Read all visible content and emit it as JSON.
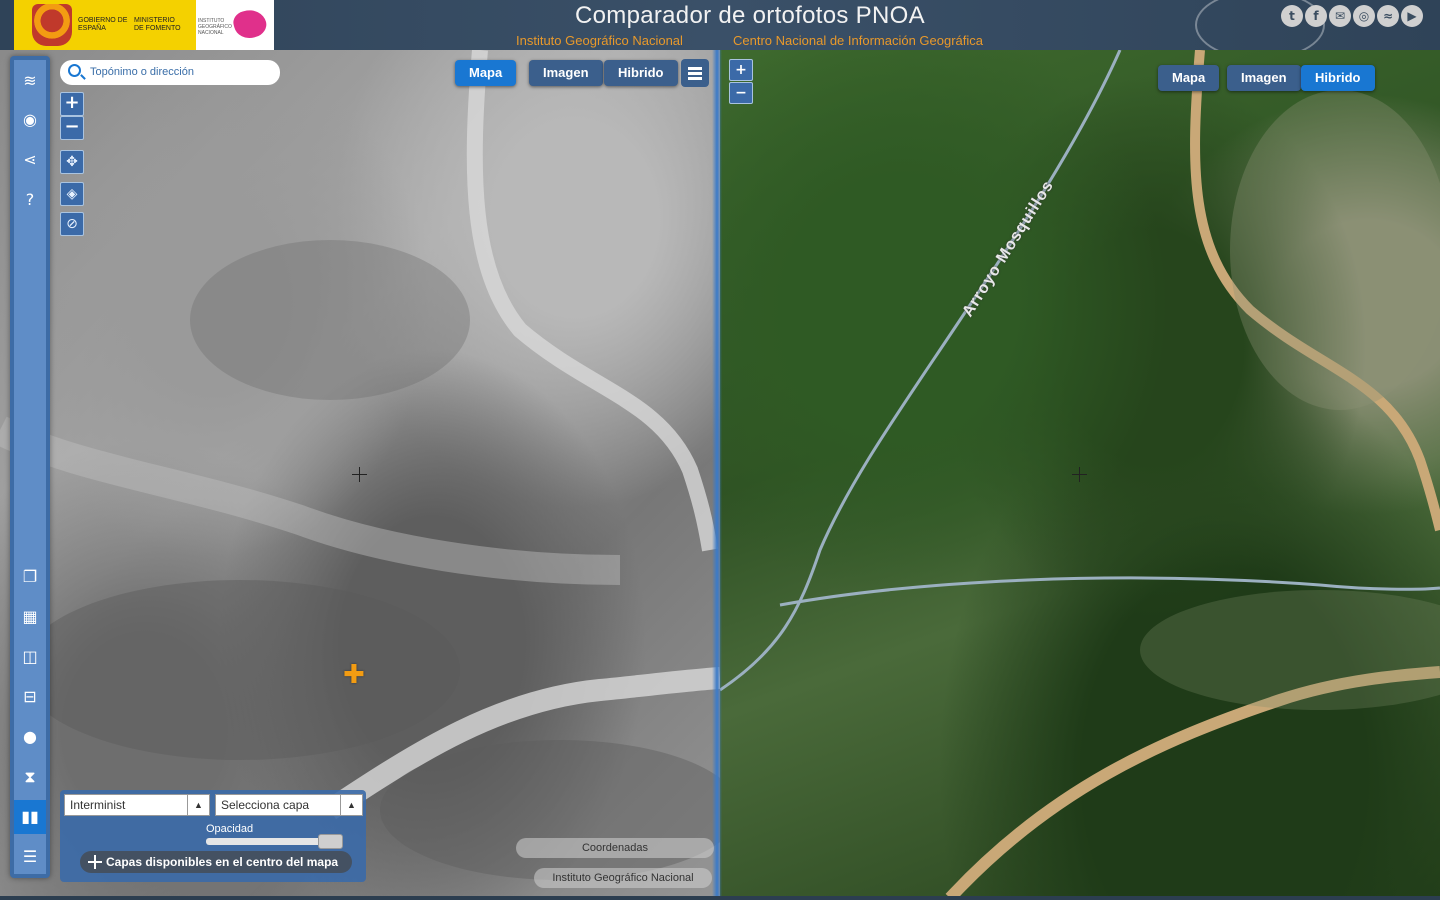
{
  "header": {
    "title": "Comparador de ortofotos PNOA",
    "subtitle_left": "Instituto Geográfico Nacional",
    "subtitle_right": "Centro Nacional de Información Geográfica",
    "logo_gobierno": "GOBIERNO DE ESPAÑA",
    "logo_ministerio": "MINISTERIO DE FOMENTO",
    "logo_ign": "INSTITUTO GEOGRÁFICO NACIONAL",
    "social": [
      {
        "icon": "twitter-icon",
        "glyph": "t"
      },
      {
        "icon": "facebook-icon",
        "glyph": "f"
      },
      {
        "icon": "email-icon",
        "glyph": "✉"
      },
      {
        "icon": "instagram-icon",
        "glyph": "◎"
      },
      {
        "icon": "rss-icon",
        "glyph": "≈"
      },
      {
        "icon": "youtube-icon",
        "glyph": "▶"
      }
    ]
  },
  "sidebar": {
    "top_items": [
      {
        "name": "layers-icon",
        "glyph": "≋"
      },
      {
        "name": "eye-icon",
        "glyph": "◉"
      },
      {
        "name": "share-icon",
        "glyph": "⋖"
      },
      {
        "name": "help-icon",
        "glyph": "?"
      }
    ],
    "bottom_items": [
      {
        "name": "overlay-icon",
        "glyph": "❐"
      },
      {
        "name": "quad-view-icon",
        "glyph": "▦"
      },
      {
        "name": "vertical-split-icon",
        "glyph": "◫"
      },
      {
        "name": "horizontal-split-icon",
        "glyph": "⊟"
      },
      {
        "name": "circle-lens-icon",
        "glyph": "●"
      },
      {
        "name": "hourglass-icon",
        "glyph": "⧗"
      },
      {
        "name": "side-by-side-icon",
        "glyph": "▮▮",
        "active": true
      },
      {
        "name": "stacked-view-icon",
        "glyph": "☰"
      }
    ]
  },
  "search": {
    "placeholder": "Topónimo o dirección"
  },
  "left_map": {
    "zoom_in": "+",
    "zoom_out": "−",
    "buttons": {
      "map": "Mapa",
      "image": "Imagen",
      "hybrid": "Hibrido"
    },
    "active": "map",
    "year_select": "Interminist",
    "layer_select": "Selecciona capa",
    "opacity_label": "Opacidad",
    "opacity_value": 0.9,
    "center_layers_button": "Capas disponibles en el centro del mapa",
    "coordinates_pill": "Coordenadas",
    "attribution_pill": "Instituto Geográfico Nacional"
  },
  "right_map": {
    "zoom_in": "+",
    "zoom_out": "−",
    "buttons": {
      "map": "Mapa",
      "image": "Imagen",
      "hybrid": "Hibrido"
    },
    "active": "hybrid",
    "place_label": "Arroyo Mosquillos"
  },
  "colors": {
    "accent": "#1977d2",
    "header_bg": "#2f4358",
    "subtitle": "#e8992b",
    "marker": "#f39c12"
  }
}
